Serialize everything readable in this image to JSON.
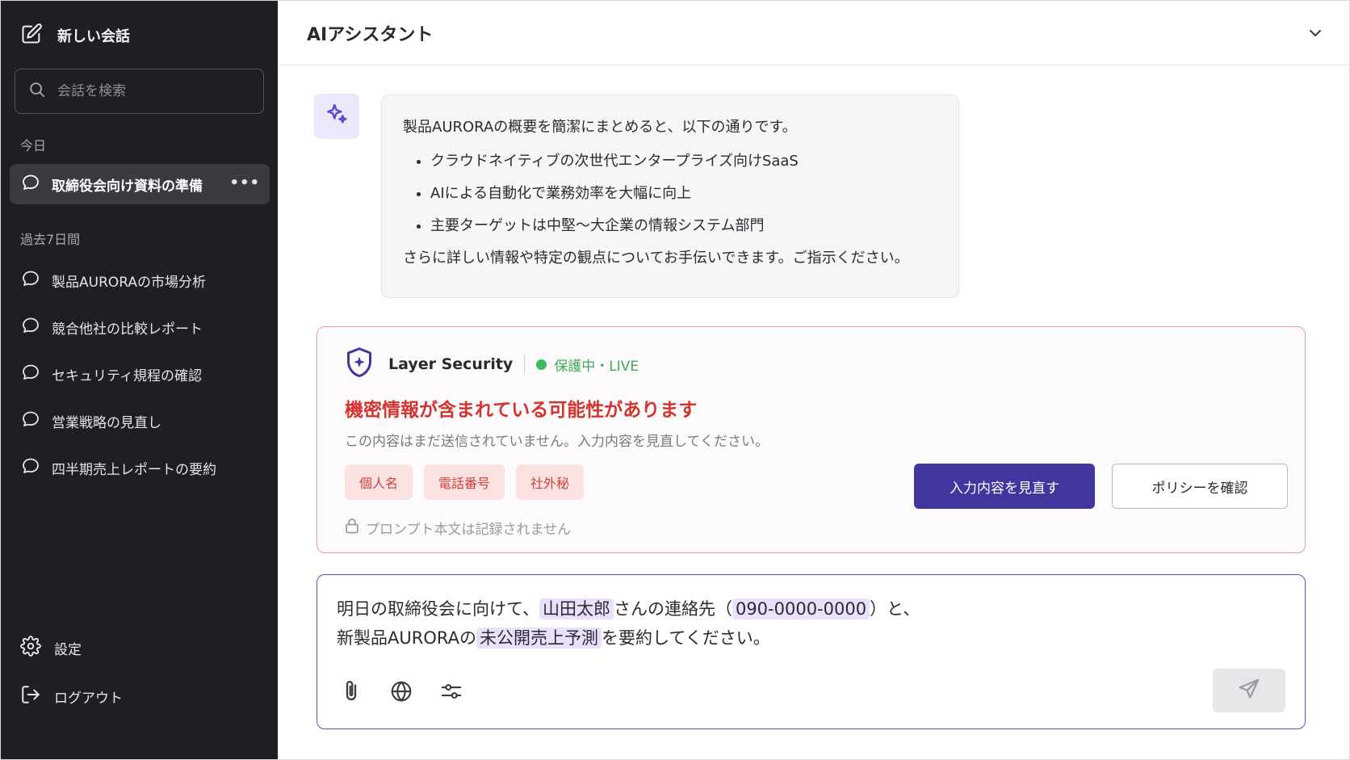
{
  "sidebar": {
    "new_chat_label": "新しい会話",
    "new_chat_icon": "edit-icon",
    "search_placeholder": "会話を検索",
    "section_today": "今日",
    "today_items": [
      {
        "label": "取締役会向け資料の準備",
        "active": true
      }
    ],
    "more_glyph": "•••",
    "section_past7": "過去7日間",
    "past7_items": [
      {
        "label": "製品AURORAの市場分析"
      },
      {
        "label": "競合他社の比較レポート"
      },
      {
        "label": "セキュリティ規程の確認"
      },
      {
        "label": "営業戦略の見直し"
      },
      {
        "label": "四半期売上レポートの要約"
      }
    ],
    "settings_label": "設定",
    "logout_label": "ログアウト"
  },
  "header": {
    "title": "AIアシスタント",
    "dropdown_icon": "chevron-down-icon"
  },
  "assistant_message": {
    "icon": "sparkle-icon",
    "intro": "製品AURORAの概要を簡潔にまとめると、以下の通りです。",
    "bullets": [
      "クラウドネイティブの次世代エンタープライズ向けSaaS",
      "AIによる自動化で業務効率を大幅に向上",
      "主要ターゲットは中堅〜大企業の情報システム部門"
    ],
    "closing": "さらに詳しい情報や特定の観点についてお手伝いできます。ご指示ください。"
  },
  "security_card": {
    "brand": "Layer Security",
    "status": "保護中・LIVE",
    "status_color": "#3dbb5f",
    "title": "機密情報が含まれている可能性があります",
    "description": "この内容はまだ送信されていません。入力内容を見直してください。",
    "tags": [
      "個人名",
      "電話番号",
      "社外秘"
    ],
    "note": "プロンプト本文は記録されません",
    "primary_button": "入力内容を見直す",
    "secondary_button": "ポリシーを確認",
    "accent_color": "#43359e",
    "alert_color": "#d3342f"
  },
  "composer": {
    "line1": {
      "pre": "明日の取締役会に向けて、",
      "highlight_name": "山田太郎",
      "mid": "さんの連絡先（",
      "highlight_phone": "090-0000-0000",
      "post": "）と、"
    },
    "line2": {
      "pre": "新製品AURORAの",
      "highlight_secret": "未公開売上予測",
      "post": "を要約してください。"
    },
    "tools": [
      "paperclip-icon",
      "globe-icon",
      "sliders-icon"
    ],
    "send_icon": "send-icon"
  }
}
